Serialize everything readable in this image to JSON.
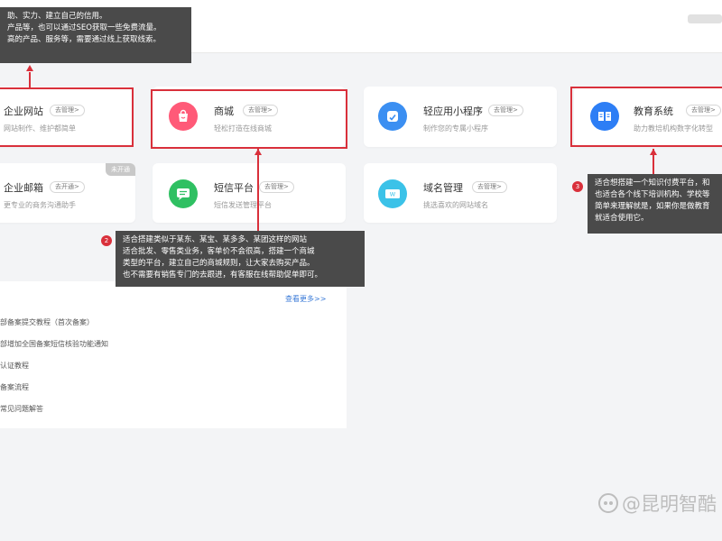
{
  "services": [
    {
      "title": "企业网站",
      "manage": "去管理>",
      "desc": "网站制作、维护都简单",
      "icon": "website-icon",
      "color": "#f2a23a"
    },
    {
      "title": "商城",
      "manage": "去管理>",
      "desc": "轻松打造在线商城",
      "icon": "shopping-bag-icon",
      "color": "#ff5a78"
    },
    {
      "title": "轻应用小程序",
      "manage": "去管理>",
      "desc": "制作您的专属小程序",
      "icon": "mini-program-icon",
      "color": "#3b8ff2"
    },
    {
      "title": "教育系统",
      "manage": "去管理>",
      "desc": "助力教培机构数字化转型",
      "icon": "book-icon",
      "color": "#2d7ef5"
    },
    {
      "title": "企业邮箱",
      "manage": "去开通>",
      "desc": "更专业的商务沟通助手",
      "badge": "未开通",
      "icon": "mail-icon",
      "color": "#f2a23a"
    },
    {
      "title": "短信平台",
      "manage": "去管理>",
      "desc": "短信发送管理平台",
      "icon": "message-icon",
      "color": "#2fc062"
    },
    {
      "title": "域名管理",
      "manage": "去管理>",
      "desc": "挑选喜欢的网站域名",
      "icon": "domain-icon",
      "color": "#3bc2e8"
    }
  ],
  "tooltips": {
    "t1": {
      "lines": [
        "助、实力、建立自己的信用。",
        "产品等，也可以通过SEO获取一些免费流量。",
        "高的产品、服务等，需要通过线上获取线索。"
      ]
    },
    "t2": {
      "number": "2",
      "lines": [
        "适合搭建类似于某东、某宝、某多多、某团这样的网站",
        "适合批发、零售类业务，客单价不会很高，搭建一个商城",
        "类型的平台，建立自己的商城规则，让大家去购买产品。",
        "也不需要有销售专门的去跟进，有客服在线帮助促单即可。"
      ]
    },
    "t3": {
      "number": "3",
      "lines": [
        "适合想搭建一个知识付费平台，和",
        "也适合各个线下培训机构、学校等",
        "简单来理解就是，如果你是做教育",
        "就适合使用它。"
      ]
    }
  },
  "news": {
    "more": "查看更多>>",
    "items": [
      "部备案提交教程（首次备案）",
      "部增加全国备案短信核验功能通知",
      "认证教程",
      "备案流程",
      "常见问题解答"
    ]
  },
  "watermark": "@昆明智酷"
}
